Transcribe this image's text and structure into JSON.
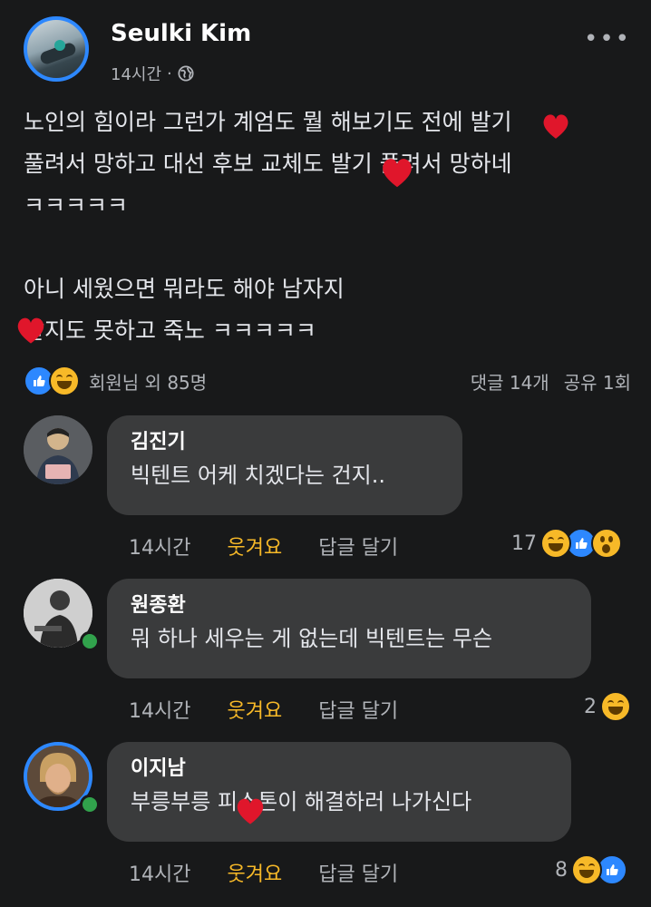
{
  "post": {
    "author": "Seulki Kim",
    "time": "14시간",
    "separator": "·",
    "more": "•••",
    "body_lines": [
      "노인의 힘이라 그런가 계엄도 뭘 해보기도 전에 발기",
      "풀려서 망하고 대선 후보 교체도 발기 풀려서 망하네",
      "ㅋㅋㅋㅋㅋ",
      "",
      "아니 세웠으면 뭐라도 해야 남자지",
      "발지도 못하고 죽노 ㅋㅋㅋㅋㅋ"
    ],
    "reaction_summary": "회원님 외 85명",
    "comments_count": "댓글 14개",
    "shares_count": "공유 1회"
  },
  "comments": [
    {
      "name": "김진기",
      "text": "빅텐트 어케 치겠다는 건지..",
      "time": "14시간",
      "laugh": "웃겨요",
      "reply": "답글 달기",
      "reaction_count": "17"
    },
    {
      "name": "원종환",
      "text": "뭐 하나 세우는 게 없는데 빅텐트는 무슨",
      "time": "14시간",
      "laugh": "웃겨요",
      "reply": "답글 달기",
      "reaction_count": "2"
    },
    {
      "name": "이지남",
      "text": "부릉부릉 피스톤이 해결하러 나가신다",
      "time": "14시간",
      "laugh": "웃겨요",
      "reply": "답글 달기",
      "reaction_count": "8"
    }
  ],
  "colors": {
    "background": "#18191a",
    "bubble": "#3a3b3c",
    "accent_blue": "#2d88ff",
    "laugh_yellow": "#f7b928",
    "online_green": "#31a24c",
    "heart_red": "#e0162b"
  }
}
